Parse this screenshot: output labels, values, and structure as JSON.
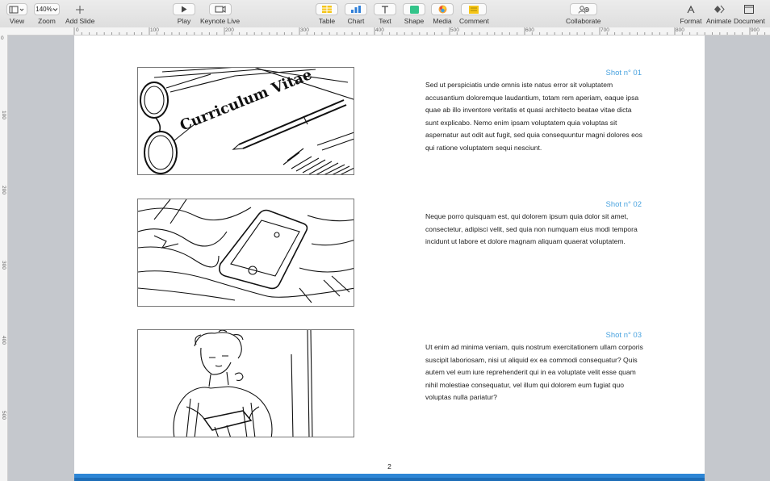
{
  "toolbar": {
    "view_label": "View",
    "zoom_value": "140%",
    "zoom_label": "Zoom",
    "add_slide_label": "Add Slide",
    "play_label": "Play",
    "keynote_live_label": "Keynote Live",
    "table_label": "Table",
    "chart_label": "Chart",
    "text_label": "Text",
    "shape_label": "Shape",
    "media_label": "Media",
    "comment_label": "Comment",
    "collaborate_label": "Collaborate",
    "format_label": "Format",
    "animate_label": "Animate",
    "document_label": "Document"
  },
  "ruler": {
    "h_ticks": [
      "0",
      "100",
      "200",
      "300",
      "400",
      "500",
      "600",
      "700",
      "800",
      "900"
    ],
    "v_ticks": [
      "0",
      "100",
      "200",
      "300",
      "400",
      "500"
    ]
  },
  "slide": {
    "shots": [
      {
        "title": "Shot n° 01",
        "text": "Sed ut perspiciatis unde omnis iste natus error sit voluptatem accusantium doloremque laudantium, totam rem aperiam, eaque ipsa quae ab illo inventore veritatis et quasi architecto beatae vitae dicta sunt explicabo. Nemo enim ipsam voluptatem quia voluptas sit aspernatur aut odit aut fugit, sed quia consequuntur magni dolores eos qui ratione voluptatem sequi nesciunt.",
        "sketch_text": "Curriculum Vitae"
      },
      {
        "title": "Shot n° 02",
        "text": "Neque porro quisquam est, qui dolorem ipsum quia dolor sit amet, consectetur, adipisci velit, sed quia non numquam eius modi tempora incidunt ut labore et dolore magnam aliquam quaerat voluptatem."
      },
      {
        "title": "Shot n° 03",
        "text": "Ut enim ad minima veniam, quis nostrum exercitationem ullam corporis suscipit laboriosam, nisi ut aliquid ex ea commodi consequatur? Quis autem vel eum iure reprehenderit qui in ea voluptate velit esse quam nihil molestiae consequatur, vel illum qui dolorem eum fugiat quo voluptas nulla pariatur?"
      }
    ],
    "page_number": "2"
  },
  "colors": {
    "accent": "#4aa3df",
    "footer": "#2d86d6",
    "canvas_bg": "#c5c8cd"
  }
}
